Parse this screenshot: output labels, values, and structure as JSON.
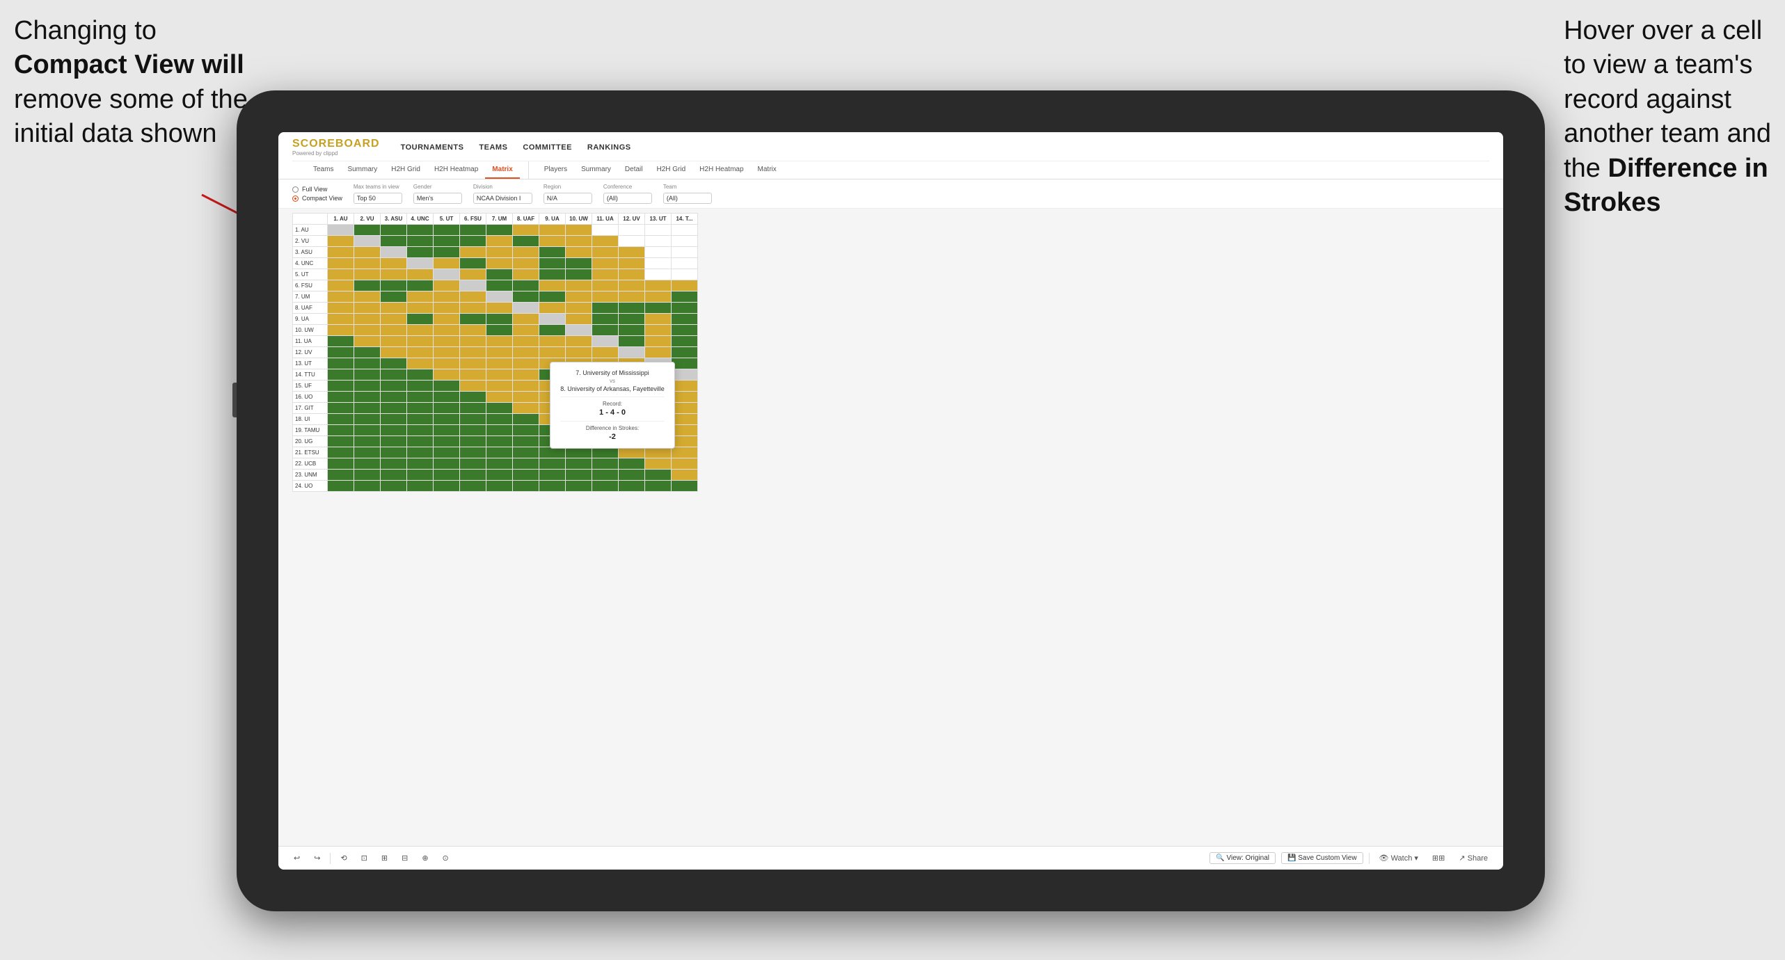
{
  "annotation_left": {
    "line1": "Changing to",
    "line2": "Compact View will",
    "line3": "remove some of the",
    "line4": "initial data shown"
  },
  "annotation_right": {
    "line1": "Hover over a cell",
    "line2": "to view a team's",
    "line3": "record against",
    "line4": "another team and",
    "line5": "the ",
    "line5b": "Difference in",
    "line6": "Strokes"
  },
  "app": {
    "logo": "SCOREBOARD",
    "logo_sub": "Powered by clippd",
    "nav": [
      "TOURNAMENTS",
      "TEAMS",
      "COMMITTEE",
      "RANKINGS"
    ],
    "sub_nav_group1": [
      "Teams",
      "Summary",
      "H2H Grid",
      "H2H Heatmap",
      "Matrix"
    ],
    "sub_nav_group2": [
      "Players",
      "Summary",
      "Detail",
      "H2H Grid",
      "H2H Heatmap",
      "Matrix"
    ],
    "active_tab": "Matrix",
    "filters": {
      "view_full": "Full View",
      "view_compact": "Compact View",
      "view_selected": "compact",
      "max_teams_label": "Max teams in view",
      "max_teams_value": "Top 50",
      "gender_label": "Gender",
      "gender_value": "Men's",
      "division_label": "Division",
      "division_value": "NCAA Division I",
      "region_label": "Region",
      "region_value": "N/A",
      "conference_label": "Conference",
      "conference_value": "(All)",
      "team_label": "Team",
      "team_value": "(All)"
    },
    "col_headers": [
      "1. AU",
      "2. VU",
      "3. ASU",
      "4. UNC",
      "5. UT",
      "6. FSU",
      "7. UM",
      "8. UAF",
      "9. UA",
      "10. UW",
      "11. UA",
      "12. UV",
      "13. UT",
      "14. T..."
    ],
    "row_labels": [
      "1. AU",
      "2. VU",
      "3. ASU",
      "4. UNC",
      "5. UT",
      "6. FSU",
      "7. UM",
      "8. UAF",
      "9. UA",
      "10. UW",
      "11. UA",
      "12. UV",
      "13. UT",
      "14. TTU",
      "15. UF",
      "16. UO",
      "17. GIT",
      "18. UI",
      "19. TAMU",
      "20. UG",
      "21. ETSU",
      "22. UCB",
      "23. UNM",
      "24. UO"
    ],
    "tooltip": {
      "team1": "7. University of Mississippi",
      "vs": "vs",
      "team2": "8. University of Arkansas, Fayetteville",
      "record_label": "Record:",
      "record_value": "1 - 4 - 0",
      "diff_label": "Difference in Strokes:",
      "diff_value": "-2"
    },
    "toolbar": {
      "undo": "↩",
      "redo": "↪",
      "icon1": "⟲",
      "icon2": "⊡",
      "icon3": "⊞",
      "icon4": "⊟",
      "icon5": "⊕",
      "icon6": "⊙",
      "view_original": "View: Original",
      "save_custom": "Save Custom View",
      "watch": "Watch ▾",
      "share": "Share"
    }
  }
}
